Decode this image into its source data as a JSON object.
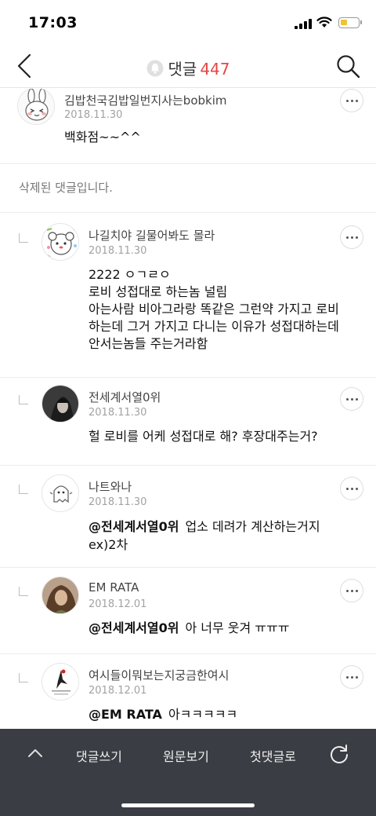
{
  "status_bar": {
    "time": "17:03",
    "battery_color": "#f0c330"
  },
  "nav": {
    "title": "댓글",
    "count": "447",
    "count_color": "#e84545"
  },
  "comments": [
    {
      "nick": "김밥천국김밥일번지사는bobkim",
      "date": "2018.11.30",
      "body": "백화점~~^^"
    },
    {
      "deleted_text": "삭제된 댓글입니다."
    },
    {
      "nick": "나길치야 길물어봐도 몰라",
      "date": "2018.11.30",
      "body": [
        "2222 ㅇㄱㄹㅇ",
        "로비 성접대로 하는놈 널림",
        "아는사람 비아그라랑 똑같은 그런약 가지고 로비",
        "하는데 그거 가지고 다니는 이유가 성접대하는데",
        "안서는놈들 주는거라함"
      ]
    },
    {
      "nick": "전세계서열0위",
      "date": "2018.11.30",
      "body": "헐 로비를 어케 성접대로 해? 후장대주는거?"
    },
    {
      "nick": "나트와나",
      "date": "2018.11.30",
      "mention": "@전세계서열0위",
      "body": [
        "업소 데려가 계산하는거지",
        "ex)2차"
      ]
    },
    {
      "nick": "EM RATA",
      "date": "2018.12.01",
      "mention": "@전세계서열0위",
      "body": "아 너무 웃겨 ㅠㅠㅠ"
    },
    {
      "nick": "여시들이뭐보는지궁금한여시",
      "date": "2018.12.01",
      "mention": "@EM RATA",
      "body": "아ㅋㅋㅋㅋㅋ"
    }
  ],
  "bottom_bar": {
    "write": "댓글쓰기",
    "original": "원문보기",
    "first_comment": "첫댓글로"
  }
}
